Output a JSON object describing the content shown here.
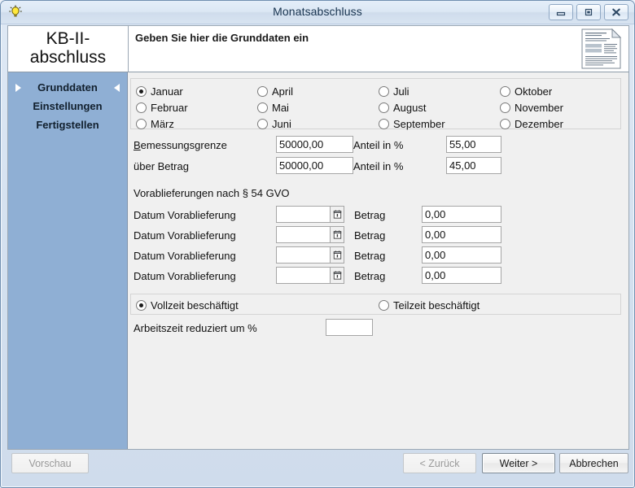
{
  "window": {
    "title": "Monatsabschluss",
    "icon": "lightbulb-icon",
    "controls": {
      "minimize": "minimize-icon",
      "maximize": "restore-icon",
      "close": "close-icon"
    }
  },
  "header": {
    "brand": "KB-II-abschluss",
    "title": "Geben Sie hier die Grunddaten ein",
    "doc_icon": "document-report-icon"
  },
  "sidebar": {
    "items": [
      {
        "label": "Grunddaten",
        "active": true
      },
      {
        "label": "Einstellungen",
        "active": false
      },
      {
        "label": "Fertigstellen",
        "active": false
      }
    ]
  },
  "form": {
    "months": {
      "columns": [
        [
          {
            "label": "Januar",
            "selected": true
          },
          {
            "label": "Februar",
            "selected": false
          },
          {
            "label": "März",
            "selected": false
          }
        ],
        [
          {
            "label": "April",
            "selected": false
          },
          {
            "label": "Mai",
            "selected": false
          },
          {
            "label": "Juni",
            "selected": false
          }
        ],
        [
          {
            "label": "Juli",
            "selected": false
          },
          {
            "label": "August",
            "selected": false
          },
          {
            "label": "September",
            "selected": false
          }
        ],
        [
          {
            "label": "Oktober",
            "selected": false
          },
          {
            "label": "November",
            "selected": false
          },
          {
            "label": "Dezember",
            "selected": false
          }
        ]
      ]
    },
    "limits": {
      "row1": {
        "label_prefix": "B",
        "label_rest": "emessungsgrenze",
        "amount": "50000,00",
        "share_label": "Anteil in %",
        "share": "55,00"
      },
      "row2": {
        "label": "über Betrag",
        "amount": "50000,00",
        "share_label": "Anteil in %",
        "share": "45,00"
      }
    },
    "advance": {
      "section_title": "Vorablieferungen nach § 54 GVO",
      "date_label": "Datum Vorablieferung",
      "amount_label": "Betrag",
      "date_picker_icon": "calendar-icon",
      "rows": [
        {
          "date": "",
          "amount": "0,00"
        },
        {
          "date": "",
          "amount": "0,00"
        },
        {
          "date": "",
          "amount": "0,00"
        },
        {
          "date": "",
          "amount": "0,00"
        }
      ]
    },
    "employment": {
      "fulltime": {
        "label": "Vollzeit beschäftigt",
        "selected": true
      },
      "parttime": {
        "label": "Teilzeit beschäftigt",
        "selected": false
      },
      "reduction_label": "Arbeitszeit reduziert um %",
      "reduction_value": ""
    }
  },
  "footer": {
    "preview": {
      "label": "Vorschau",
      "disabled": true
    },
    "back": {
      "label": "< Zurück",
      "disabled": true
    },
    "next": {
      "label": "Weiter >",
      "disabled": false,
      "default": true
    },
    "cancel": {
      "label": "Abbrechen",
      "disabled": false
    }
  },
  "colors": {
    "sidebar": "#8fafd4",
    "titlebar_text": "#17334f",
    "pane": "#f0f0f0"
  }
}
